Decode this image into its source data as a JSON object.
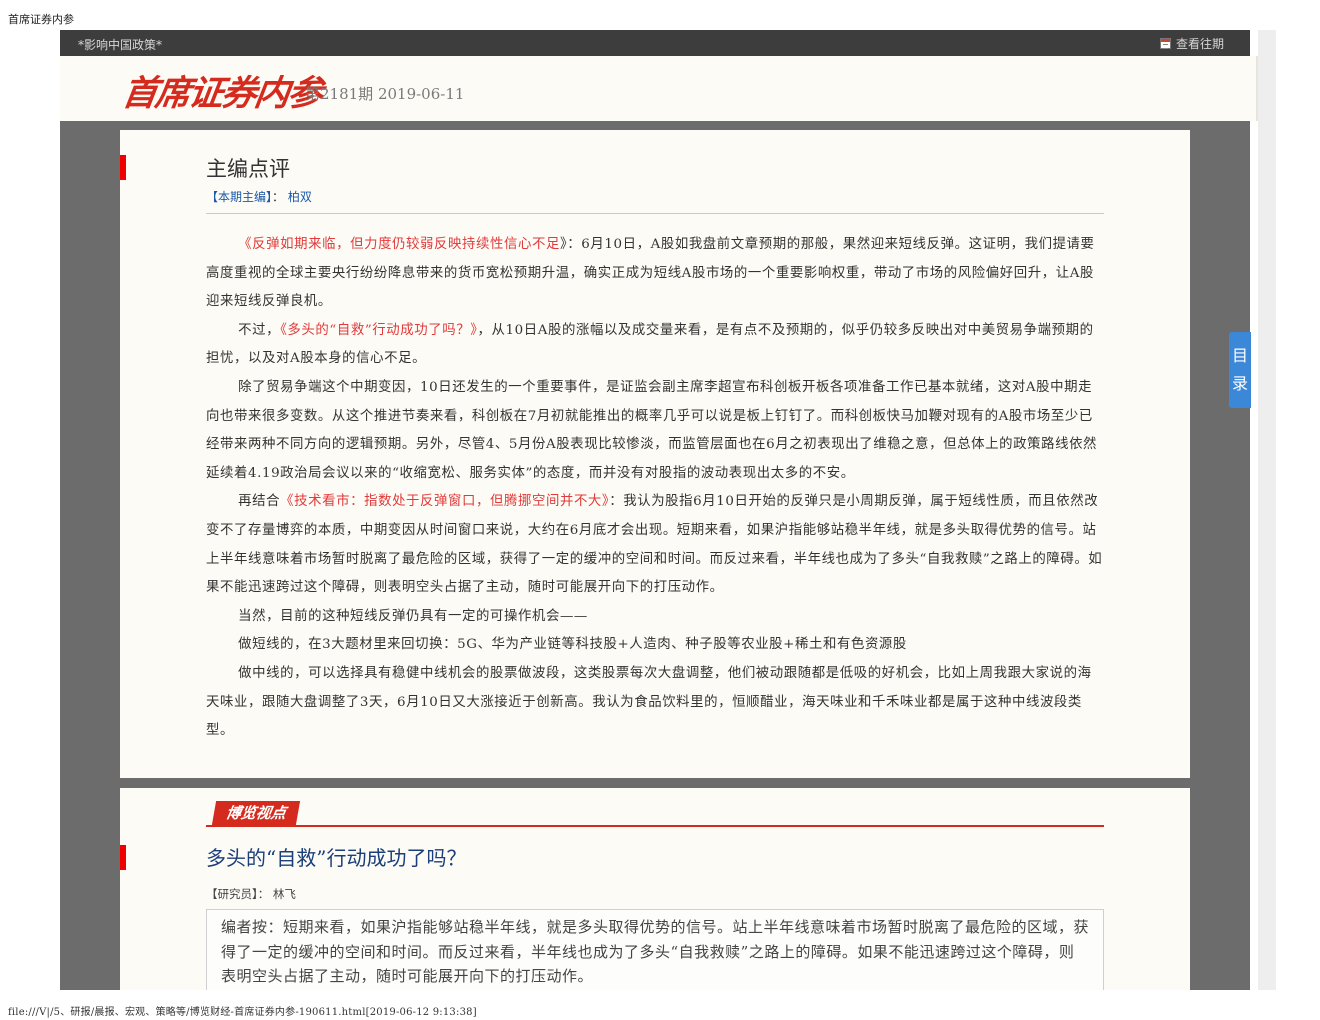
{
  "print_header": "首席证券内参",
  "print_footer": "file:///V|/5、研报/晨报、宏观、策略等/博览财经-首席证券内参-190611.html[2019-06-12 9:13:38]",
  "topbar": {
    "slogan": "*影响中国政策*",
    "history_link": "查看往期"
  },
  "header": {
    "logo_text": "首席证券内参",
    "issue_info": "第2181期 2019-06-11"
  },
  "toc_tab": {
    "char1": "目",
    "char2": "录"
  },
  "editor_section": {
    "title": "主编点评",
    "editor_label": "【本期主编】",
    "editor_sep": "：",
    "editor_name": "柏双",
    "p1_open": "《",
    "p1_link": "反弹如期来临，但力度仍较弱反映持续性信心不足",
    "p1_text": "》：6月10日，A股如我盘前文章预期的那般，果然迎来短线反弹。这证明，我们提请要高度重视的全球主要央行纷纷降息带来的货币宽松预期升温，确实正成为短线A股市场的一个重要影响权重，带动了市场的风险偏好回升，让A股迎来短线反弹良机。",
    "p2_pre": "不过，",
    "p2_link": "《多头的“自救”行动成功了吗？》",
    "p2_text": "，从10日A股的涨幅以及成交量来看，是有点不及预期的，似乎仍较多反映出对中美贸易争端预期的担忧，以及对A股本身的信心不足。",
    "p3": "除了贸易争端这个中期变因，10日还发生的一个重要事件，是证监会副主席李超宣布科创板开板各项准备工作已基本就绪，这对A股中期走向也带来很多变数。从这个推进节奏来看，科创板在7月初就能推出的概率几乎可以说是板上钉钉了。而科创板快马加鞭对现有的A股市场至少已经带来两种不同方向的逻辑预期。另外，尽管4、5月份A股表现比较惨淡，而监管层面也在6月之初表现出了维稳之意，但总体上的政策路线依然延续着4.19政治局会议以来的“收缩宽松、服务实体”的态度，而并没有对股指的波动表现出太多的不安。",
    "p4_pre": "再结合",
    "p4_link": "《技术看市：指数处于反弹窗口，但腾挪空间并不大》",
    "p4_text": "：我认为股指6月10日开始的反弹只是小周期反弹，属于短线性质，而且依然改变不了存量博弈的本质，中期变因从时间窗口来说，大约在6月底才会出现。短期来看，如果沪指能够站稳半年线，就是多头取得优势的信号。站上半年线意味着市场暂时脱离了最危险的区域，获得了一定的缓冲的空间和时间。而反过来看，半年线也成为了多头“自我救赎”之路上的障碍。如果不能迅速跨过这个障碍，则表明空头占据了主动，随时可能展开向下的打压动作。",
    "p5": "当然，目前的这种短线反弹仍具有一定的可操作机会——",
    "p6": "做短线的，在3大题材里来回切换：5G、华为产业链等科技股+人造肉、种子股等农业股+稀土和有色资源股",
    "p7": "做中线的，可以选择具有稳健中线机会的股票做波段，这类股票每次大盘调整，他们被动跟随都是低吸的好机会，比如上周我跟大家说的海天味业，跟随大盘调整了3天，6月10日又大涨接近于创新高。我认为食品饮料里的，恒顺醋业，海天味业和千禾味业都是属于这种中线波段类型。"
  },
  "article_section": {
    "badge": "博览视点",
    "title": "多头的“自救”行动成功了吗？",
    "researcher_label": "【研究员】",
    "researcher_sep": "：",
    "researcher_name": "林飞",
    "editor_note": "编者按：短期来看，如果沪指能够站稳半年线，就是多头取得优势的信号。站上半年线意味着市场暂时脱离了最危险的区域，获得了一定的缓冲的空间和时间。而反过来看，半年线也成为了多头“自我救赎”之路上的障碍。如果不能迅速跨过这个障碍，则表明空头占据了主动，随时可能展开向下的打压动作。"
  },
  "colors": {
    "accent_red": "#d52b1e",
    "link_red": "#e03a3a",
    "topbar": "#3d3d3d",
    "toc_blue": "#3b87d8"
  }
}
